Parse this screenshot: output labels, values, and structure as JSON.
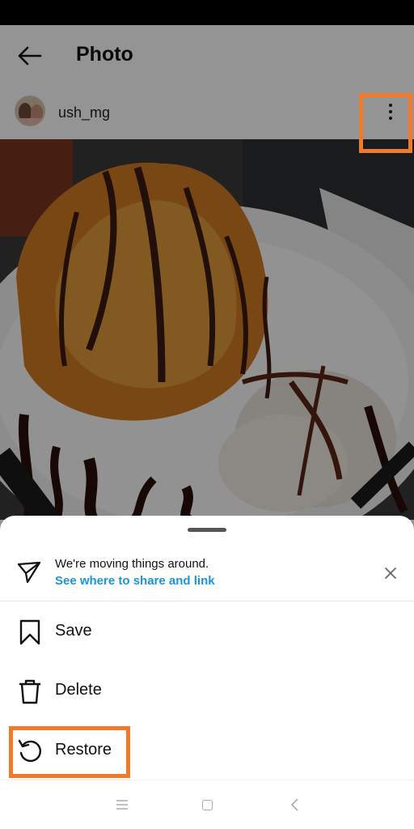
{
  "header": {
    "title": "Photo",
    "back_icon": "arrow-left-icon"
  },
  "post": {
    "username": "ush_mg",
    "more_icon": "more-vertical-icon"
  },
  "sheet": {
    "notice": {
      "text": "We're moving things around.",
      "link": "See where to share and link",
      "icon": "send-icon",
      "close_icon": "close-icon"
    },
    "items": [
      {
        "label": "Save",
        "icon": "bookmark-icon"
      },
      {
        "label": "Delete",
        "icon": "trash-icon"
      },
      {
        "label": "Restore",
        "icon": "restore-icon"
      }
    ]
  },
  "colors": {
    "accent_link": "#1a95d6",
    "highlight": "#f07a2a"
  }
}
